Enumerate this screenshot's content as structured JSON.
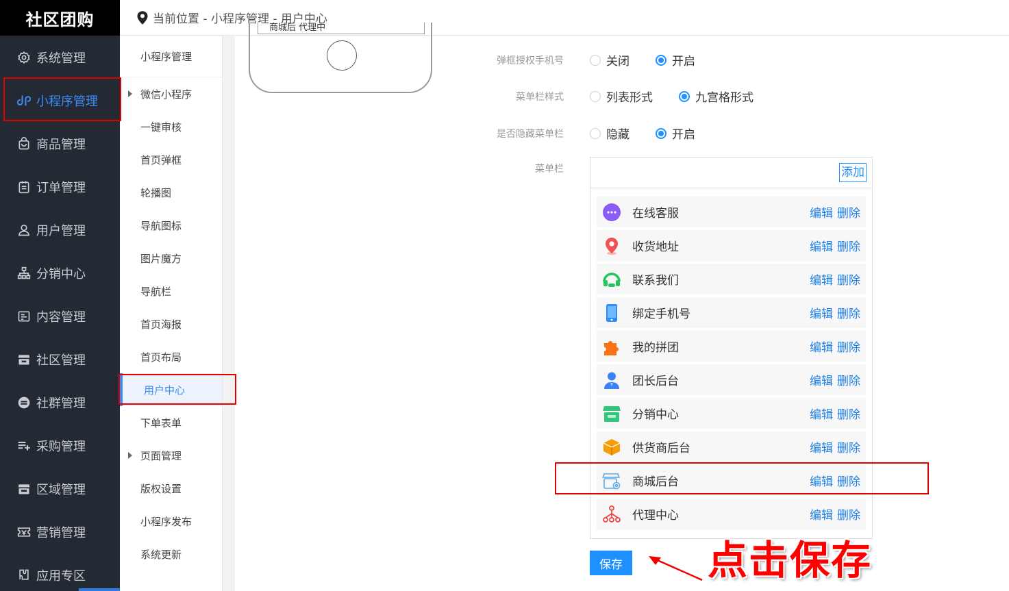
{
  "app": {
    "title": "社区团购"
  },
  "sidebar": {
    "items": [
      {
        "label": "系统管理",
        "icon": "gear-icon",
        "active": false
      },
      {
        "label": "小程序管理",
        "icon": "mini-program-icon",
        "active": true
      },
      {
        "label": "商品管理",
        "icon": "bag-icon",
        "active": false
      },
      {
        "label": "订单管理",
        "icon": "clipboard-icon",
        "active": false
      },
      {
        "label": "用户管理",
        "icon": "user-icon",
        "active": false
      },
      {
        "label": "分销中心",
        "icon": "org-chart-icon",
        "active": false
      },
      {
        "label": "内容管理",
        "icon": "content-icon",
        "active": false
      },
      {
        "label": "社区管理",
        "icon": "store-icon",
        "active": false
      },
      {
        "label": "社群管理",
        "icon": "minus-circle-icon",
        "active": false
      },
      {
        "label": "采购管理",
        "icon": "list-plus-icon",
        "active": false
      },
      {
        "label": "区域管理",
        "icon": "shop-icon",
        "active": false
      },
      {
        "label": "营销管理",
        "icon": "ticket-icon",
        "active": false
      },
      {
        "label": "应用专区",
        "icon": "puzzle-icon",
        "active": false
      }
    ]
  },
  "breadcrumb": {
    "text": "当前位置 - 小程序管理 - 用户中心"
  },
  "submenu": {
    "items": [
      {
        "label": "小程序管理",
        "arrow": false
      },
      {
        "label": "微信小程序",
        "arrow": true
      },
      {
        "label": "一键审核",
        "arrow": false
      },
      {
        "label": "首页弹框",
        "arrow": false
      },
      {
        "label": "轮播图",
        "arrow": false
      },
      {
        "label": "导航图标",
        "arrow": false
      },
      {
        "label": "图片魔方",
        "arrow": false
      },
      {
        "label": "导航栏",
        "arrow": false
      },
      {
        "label": "首页海报",
        "arrow": false
      },
      {
        "label": "首页布局",
        "arrow": false
      },
      {
        "label": "用户中心",
        "arrow": false,
        "active": true
      },
      {
        "label": "下单表单",
        "arrow": false
      },
      {
        "label": "页面管理",
        "arrow": true
      },
      {
        "label": "版权设置",
        "arrow": false
      },
      {
        "label": "小程序发布",
        "arrow": false
      },
      {
        "label": "系统更新",
        "arrow": false
      }
    ]
  },
  "preview": {
    "screen_text": "商城后  代理中"
  },
  "form": {
    "phone_auth": {
      "label": "弹框授权手机号",
      "options": [
        "关闭",
        "开启"
      ],
      "selected": 1
    },
    "menu_style": {
      "label": "菜单栏样式",
      "options": [
        "列表形式",
        "九宫格形式"
      ],
      "selected": 1
    },
    "hide_menu": {
      "label": "是否隐藏菜单栏",
      "options": [
        "隐藏",
        "开启"
      ],
      "selected": 1
    },
    "menu_label": "菜单栏",
    "add_label": "添加",
    "edit_label": "编辑",
    "delete_label": "删除",
    "save_label": "保存"
  },
  "menu_items": [
    {
      "name": "在线客服",
      "icon": "chat-bubble-icon",
      "color": "#8b5cf6"
    },
    {
      "name": "收货地址",
      "icon": "location-pin-icon",
      "color": "#f05252"
    },
    {
      "name": "联系我们",
      "icon": "headset-icon",
      "color": "#22c55e"
    },
    {
      "name": "绑定手机号",
      "icon": "phone-icon",
      "color": "#2f8ef4"
    },
    {
      "name": "我的拼团",
      "icon": "puzzle-icon",
      "color": "#f97316"
    },
    {
      "name": "团长后台",
      "icon": "user-icon",
      "color": "#3b82f6"
    },
    {
      "name": "分销中心",
      "icon": "store-icon",
      "color": "#34c77b"
    },
    {
      "name": "供货商后台",
      "icon": "box-icon",
      "color": "#f59e0b"
    },
    {
      "name": "商城后台",
      "icon": "shop-settings-icon",
      "color": "#5aa9e6"
    },
    {
      "name": "代理中心",
      "icon": "network-icon",
      "color": "#ef4444"
    }
  ],
  "annotation": {
    "text": "点击保存",
    "color": "#ff0000"
  }
}
